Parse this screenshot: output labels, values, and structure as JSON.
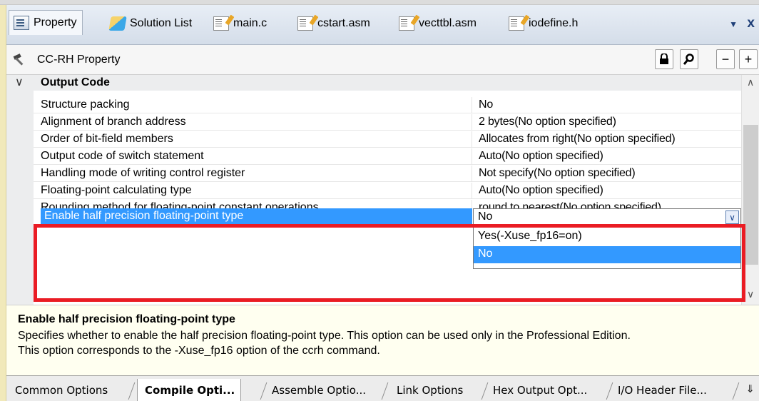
{
  "doc_tabs": [
    {
      "label": "Property",
      "icon": "property-icon"
    },
    {
      "label": "Solution List",
      "icon": "solution-list-icon"
    },
    {
      "label": "main.c",
      "icon": "file-icon"
    },
    {
      "label": "cstart.asm",
      "icon": "file-icon"
    },
    {
      "label": "vecttbl.asm",
      "icon": "file-icon"
    },
    {
      "label": "iodefine.h",
      "icon": "file-icon"
    }
  ],
  "tab_menu_glyph": "▼",
  "tab_close_glyph": "x",
  "property_header": {
    "title": "CC-RH Property",
    "icon": "hammer-icon",
    "buttons": [
      "lock-icon",
      "search-icon",
      "collapse-icon",
      "expand-icon"
    ],
    "collapse_label": "−",
    "expand_label": "+"
  },
  "category": {
    "label": "Output Code",
    "chevron": "∨"
  },
  "rows": [
    {
      "name": "Structure packing",
      "value": "No"
    },
    {
      "name": "Alignment of branch address",
      "value": "2 bytes(No option specified)"
    },
    {
      "name": "Order of bit-field members",
      "value": "Allocates from right(No option specified)"
    },
    {
      "name": "Output code of switch statement",
      "value": "Auto(No option specified)"
    },
    {
      "name": "Handling mode of writing control register",
      "value": "Not specify(No option specified)"
    },
    {
      "name": "Floating-point calculating type",
      "value": "Auto(No option specified)"
    },
    {
      "name": "Rounding method for floating-point constant operations",
      "value": "round to nearest(No option specified)"
    }
  ],
  "selected_row": {
    "name": "Enable half precision floating-point type",
    "value": "No",
    "options": [
      "Yes(-Xuse_fp16=on)",
      "No"
    ],
    "selected_option": "No"
  },
  "description": {
    "title": "Enable half precision floating-point type",
    "line1": "Specifies whether to enable the half precision floating-point type. This option can be used only in the Professional Edition.",
    "line2": "This option corresponds to the -Xuse_fp16 option of the ccrh command."
  },
  "bottom_tabs": [
    {
      "label": "Common Options",
      "active": false
    },
    {
      "label": "Compile Opti...",
      "active": true
    },
    {
      "label": "Assemble Optio...",
      "active": false
    },
    {
      "label": "Link Options",
      "active": false
    },
    {
      "label": "Hex Output Opt...",
      "active": false
    },
    {
      "label": "I/O Header File...",
      "active": false
    }
  ],
  "colors": {
    "selection": "#3399ff",
    "highlight_box": "#ea1c24",
    "description_bg": "#fffff0"
  }
}
